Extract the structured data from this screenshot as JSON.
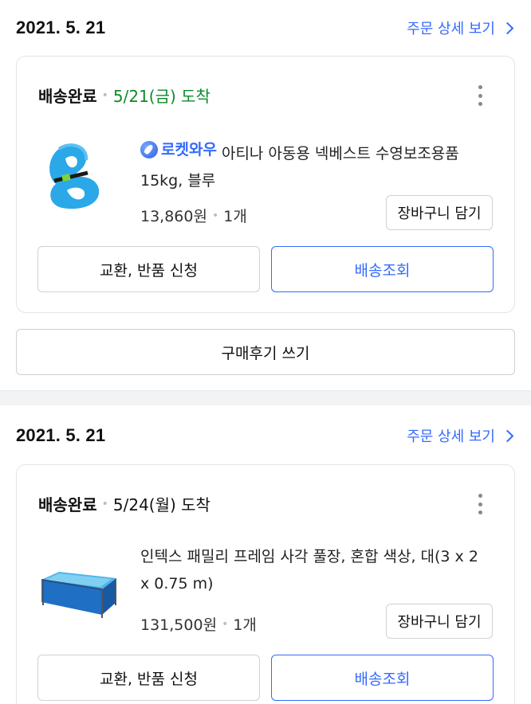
{
  "orders": [
    {
      "date": "2021. 5. 21",
      "detail_link": "주문 상세 보기",
      "status": "배송완료",
      "arrival": "5/21(금) 도착",
      "badge": "로켓와우",
      "product_name": "아티나 아동용 넥베스트 수영보조용품",
      "product_option": "15kg, 블루",
      "price": "13,860원",
      "quantity": "1개",
      "cart_button": "장바구니 담기",
      "exchange_button": "교환, 반품 신청",
      "tracking_button": "배송조회",
      "review_button": "구매후기 쓰기"
    },
    {
      "date": "2021. 5. 21",
      "detail_link": "주문 상세 보기",
      "status": "배송완료",
      "arrival": "5/24(월) 도착",
      "product_name_line1": "인텍스 패밀리 프레임 사각 풀장, 혼합 색상, 대(3 x 2",
      "product_name_line2": "x 0.75 m)",
      "price": "131,500원",
      "quantity": "1개",
      "cart_button": "장바구니 담기",
      "exchange_button": "교환, 반품 신청",
      "tracking_button": "배송조회"
    }
  ],
  "colors": {
    "accent": "#346aff",
    "arrival_green": "#0e8a2a",
    "divider": "#f2f3f5"
  },
  "icons": {
    "chevron": "chevron-right-icon",
    "more": "more-vertical-icon",
    "rocket": "rocket-wow-icon"
  }
}
